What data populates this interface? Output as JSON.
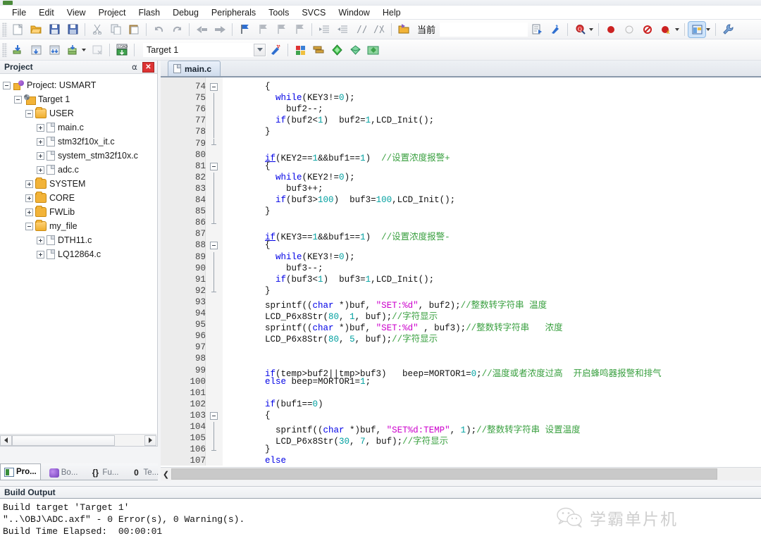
{
  "menu": {
    "items": [
      "File",
      "Edit",
      "View",
      "Project",
      "Flash",
      "Debug",
      "Peripherals",
      "Tools",
      "SVCS",
      "Window",
      "Help"
    ]
  },
  "toolbar1": {
    "icons": [
      "new-file-icon",
      "open-file-icon",
      "save-icon",
      "save-all-icon",
      "cut-icon",
      "copy-icon",
      "paste-icon",
      "undo-icon",
      "redo-icon",
      "navigate-back-icon",
      "navigate-forward-icon",
      "bookmark-toggle-icon",
      "bookmark-prev-icon",
      "bookmark-next-icon",
      "bookmark-clear-icon",
      "indent-icon",
      "outdent-icon",
      "comment-icon",
      "uncomment-icon",
      "open-project-icon"
    ],
    "current_label": "当前",
    "right_icons": [
      "target-options-icon",
      "configure-icon",
      "find-in-files-icon",
      "insert-breakpoint-icon",
      "disable-breakpoint-icon",
      "kill-breakpoints-icon",
      "disable-all-breakpoints-icon",
      "window-manage-icon",
      "utilities-icon"
    ]
  },
  "toolbar2": {
    "icons": [
      "translate-icon",
      "build-icon",
      "rebuild-all-icon",
      "batch-build-icon",
      "stop-build-icon",
      "download-icon"
    ],
    "target_value": "Target 1",
    "right_icons": [
      "target-options-wizard-icon",
      "manage-project-items-icon",
      "manage-multi-project-icon",
      "run-configuration-icon",
      "pack-installer-icon",
      "manage-runtime-env-icon"
    ]
  },
  "project_panel": {
    "title": "Project",
    "pin_icon": "pin-icon",
    "close_icon": "close-icon",
    "tree": [
      {
        "label": "Project: USMART",
        "depth": 0,
        "toggle": "minus",
        "icon": "project-icon"
      },
      {
        "label": "Target 1",
        "depth": 1,
        "toggle": "minus",
        "icon": "target-icon"
      },
      {
        "label": "USER",
        "depth": 2,
        "toggle": "minus",
        "icon": "folder-open-icon"
      },
      {
        "label": "main.c",
        "depth": 3,
        "toggle": "plus",
        "icon": "c-file-icon"
      },
      {
        "label": "stm32f10x_it.c",
        "depth": 3,
        "toggle": "plus",
        "icon": "c-file-icon"
      },
      {
        "label": "system_stm32f10x.c",
        "depth": 3,
        "toggle": "plus",
        "icon": "c-file-icon"
      },
      {
        "label": "adc.c",
        "depth": 3,
        "toggle": "plus",
        "icon": "c-file-icon"
      },
      {
        "label": "SYSTEM",
        "depth": 2,
        "toggle": "plus",
        "icon": "folder-icon"
      },
      {
        "label": "CORE",
        "depth": 2,
        "toggle": "plus",
        "icon": "folder-icon"
      },
      {
        "label": "FWLib",
        "depth": 2,
        "toggle": "plus",
        "icon": "folder-icon"
      },
      {
        "label": "my_file",
        "depth": 2,
        "toggle": "minus",
        "icon": "folder-open-icon"
      },
      {
        "label": "DTH11.c",
        "depth": 3,
        "toggle": "plus",
        "icon": "c-file-icon"
      },
      {
        "label": "LQ12864.c",
        "depth": 3,
        "toggle": "plus",
        "icon": "c-file-icon"
      }
    ]
  },
  "left_tabs": [
    {
      "label": "Pro...",
      "icon": "project-tab-icon",
      "active": true
    },
    {
      "label": "Bo...",
      "icon": "books-tab-icon",
      "active": false
    },
    {
      "label": "Fu...",
      "icon": "functions-tab-icon",
      "active": false
    },
    {
      "label": "Te...",
      "icon": "templates-tab-icon",
      "active": false
    }
  ],
  "editor": {
    "tab_label": "main.c",
    "tab_icon": "c-file-icon",
    "first_line": 74,
    "lines": [
      {
        "n": 74,
        "fold": "start",
        "tokens": [
          {
            "t": "        {",
            "c": ""
          }
        ]
      },
      {
        "n": 75,
        "fold": "bar",
        "tokens": [
          {
            "t": "          ",
            "c": ""
          },
          {
            "t": "while",
            "c": "kw"
          },
          {
            "t": "(KEY3!=",
            "c": ""
          },
          {
            "t": "0",
            "c": "num"
          },
          {
            "t": ");",
            "c": ""
          }
        ]
      },
      {
        "n": 76,
        "fold": "bar",
        "tokens": [
          {
            "t": "            buf2--;",
            "c": ""
          }
        ]
      },
      {
        "n": 77,
        "fold": "bar",
        "tokens": [
          {
            "t": "          ",
            "c": ""
          },
          {
            "t": "if",
            "c": "kw"
          },
          {
            "t": "(buf2<",
            "c": ""
          },
          {
            "t": "1",
            "c": "num"
          },
          {
            "t": ")  buf2=",
            "c": ""
          },
          {
            "t": "1",
            "c": "num"
          },
          {
            "t": ",LCD_Init();",
            "c": ""
          }
        ]
      },
      {
        "n": 78,
        "fold": "bar",
        "tokens": [
          {
            "t": "        }",
            "c": ""
          }
        ]
      },
      {
        "n": 79,
        "fold": "end",
        "tokens": [
          {
            "t": "",
            "c": ""
          }
        ]
      },
      {
        "n": 80,
        "fold": "",
        "tokens": [
          {
            "t": "        ",
            "c": ""
          },
          {
            "t": "if",
            "c": "kwu"
          },
          {
            "t": "(KEY2==",
            "c": ""
          },
          {
            "t": "1",
            "c": "num"
          },
          {
            "t": "&&buf1==",
            "c": ""
          },
          {
            "t": "1",
            "c": "num"
          },
          {
            "t": ")  ",
            "c": ""
          },
          {
            "t": "//设置浓度报警+",
            "c": "cmt"
          }
        ]
      },
      {
        "n": 81,
        "fold": "start",
        "tokens": [
          {
            "t": "        {",
            "c": ""
          }
        ]
      },
      {
        "n": 82,
        "fold": "bar",
        "tokens": [
          {
            "t": "          ",
            "c": ""
          },
          {
            "t": "while",
            "c": "kw"
          },
          {
            "t": "(KEY2!=",
            "c": ""
          },
          {
            "t": "0",
            "c": "num"
          },
          {
            "t": ");",
            "c": ""
          }
        ]
      },
      {
        "n": 83,
        "fold": "bar",
        "tokens": [
          {
            "t": "            buf3++;",
            "c": ""
          }
        ]
      },
      {
        "n": 84,
        "fold": "bar",
        "tokens": [
          {
            "t": "          ",
            "c": ""
          },
          {
            "t": "if",
            "c": "kw"
          },
          {
            "t": "(buf3>",
            "c": ""
          },
          {
            "t": "100",
            "c": "num"
          },
          {
            "t": ")  buf3=",
            "c": ""
          },
          {
            "t": "100",
            "c": "num"
          },
          {
            "t": ",LCD_Init();",
            "c": ""
          }
        ]
      },
      {
        "n": 85,
        "fold": "bar",
        "tokens": [
          {
            "t": "        }",
            "c": ""
          }
        ]
      },
      {
        "n": 86,
        "fold": "end",
        "tokens": [
          {
            "t": "",
            "c": ""
          }
        ]
      },
      {
        "n": 87,
        "fold": "",
        "tokens": [
          {
            "t": "        ",
            "c": ""
          },
          {
            "t": "if",
            "c": "kwu"
          },
          {
            "t": "(KEY3==",
            "c": ""
          },
          {
            "t": "1",
            "c": "num"
          },
          {
            "t": "&&buf1==",
            "c": ""
          },
          {
            "t": "1",
            "c": "num"
          },
          {
            "t": ")  ",
            "c": ""
          },
          {
            "t": "//设置浓度报警-",
            "c": "cmt"
          }
        ]
      },
      {
        "n": 88,
        "fold": "start",
        "tokens": [
          {
            "t": "        {",
            "c": ""
          }
        ]
      },
      {
        "n": 89,
        "fold": "bar",
        "tokens": [
          {
            "t": "          ",
            "c": ""
          },
          {
            "t": "while",
            "c": "kw"
          },
          {
            "t": "(KEY3!=",
            "c": ""
          },
          {
            "t": "0",
            "c": "num"
          },
          {
            "t": ");",
            "c": ""
          }
        ]
      },
      {
        "n": 90,
        "fold": "bar",
        "tokens": [
          {
            "t": "            buf3--;",
            "c": ""
          }
        ]
      },
      {
        "n": 91,
        "fold": "bar",
        "tokens": [
          {
            "t": "          ",
            "c": ""
          },
          {
            "t": "if",
            "c": "kw"
          },
          {
            "t": "(buf3<",
            "c": ""
          },
          {
            "t": "1",
            "c": "num"
          },
          {
            "t": ")  buf3=",
            "c": ""
          },
          {
            "t": "1",
            "c": "num"
          },
          {
            "t": ",LCD_Init();",
            "c": ""
          }
        ]
      },
      {
        "n": 92,
        "fold": "end",
        "tokens": [
          {
            "t": "        }",
            "c": ""
          }
        ]
      },
      {
        "n": 93,
        "fold": "",
        "tokens": [
          {
            "t": "        sprintf((",
            "c": ""
          },
          {
            "t": "char",
            "c": "typ"
          },
          {
            "t": " *)buf, ",
            "c": ""
          },
          {
            "t": "\"SET:%d\"",
            "c": "str"
          },
          {
            "t": ", buf2);",
            "c": ""
          },
          {
            "t": "//整数转字符串 温度",
            "c": "cmt"
          }
        ]
      },
      {
        "n": 94,
        "fold": "",
        "tokens": [
          {
            "t": "        LCD_P6x8Str(",
            "c": ""
          },
          {
            "t": "80",
            "c": "num"
          },
          {
            "t": ", ",
            "c": ""
          },
          {
            "t": "1",
            "c": "num"
          },
          {
            "t": ", buf);",
            "c": ""
          },
          {
            "t": "//字符显示",
            "c": "cmt"
          }
        ]
      },
      {
        "n": 95,
        "fold": "",
        "tokens": [
          {
            "t": "        sprintf((",
            "c": ""
          },
          {
            "t": "char",
            "c": "typ"
          },
          {
            "t": " *)buf, ",
            "c": ""
          },
          {
            "t": "\"SET:%d\"",
            "c": "str"
          },
          {
            "t": " , buf3);",
            "c": ""
          },
          {
            "t": "//整数转字符串   浓度",
            "c": "cmt"
          }
        ]
      },
      {
        "n": 96,
        "fold": "",
        "tokens": [
          {
            "t": "        LCD_P6x8Str(",
            "c": ""
          },
          {
            "t": "80",
            "c": "num"
          },
          {
            "t": ", ",
            "c": ""
          },
          {
            "t": "5",
            "c": "num"
          },
          {
            "t": ", buf);",
            "c": ""
          },
          {
            "t": "//字符显示",
            "c": "cmt"
          }
        ]
      },
      {
        "n": 97,
        "fold": "",
        "tokens": [
          {
            "t": "",
            "c": ""
          }
        ]
      },
      {
        "n": 98,
        "fold": "",
        "tokens": [
          {
            "t": "",
            "c": ""
          }
        ]
      },
      {
        "n": 99,
        "fold": "",
        "tokens": [
          {
            "t": "        ",
            "c": ""
          },
          {
            "t": "if",
            "c": "kw"
          },
          {
            "t": "(temp>buf2||tmp>buf3)   beep=MORTOR1=",
            "c": ""
          },
          {
            "t": "0",
            "c": "num"
          },
          {
            "t": ";",
            "c": ""
          },
          {
            "t": "//温度或者浓度过高  开启蜂鸣器报警和排气",
            "c": "cmt"
          }
        ]
      },
      {
        "n": 100,
        "fold": "",
        "tokens": [
          {
            "t": "        ",
            "c": ""
          },
          {
            "t": "else",
            "c": "kw"
          },
          {
            "t": " beep=MORTOR1=",
            "c": ""
          },
          {
            "t": "1",
            "c": "num"
          },
          {
            "t": ";",
            "c": ""
          }
        ]
      },
      {
        "n": 101,
        "fold": "",
        "tokens": [
          {
            "t": "",
            "c": ""
          }
        ]
      },
      {
        "n": 102,
        "fold": "",
        "tokens": [
          {
            "t": "        ",
            "c": ""
          },
          {
            "t": "if",
            "c": "kw"
          },
          {
            "t": "(buf1==",
            "c": ""
          },
          {
            "t": "0",
            "c": "num"
          },
          {
            "t": ")",
            "c": ""
          }
        ]
      },
      {
        "n": 103,
        "fold": "start",
        "tokens": [
          {
            "t": "        {",
            "c": ""
          }
        ]
      },
      {
        "n": 104,
        "fold": "bar",
        "tokens": [
          {
            "t": "          sprintf((",
            "c": ""
          },
          {
            "t": "char",
            "c": "typ"
          },
          {
            "t": " *)buf, ",
            "c": ""
          },
          {
            "t": "\"SET%d:TEMP\"",
            "c": "str"
          },
          {
            "t": ", ",
            "c": ""
          },
          {
            "t": "1",
            "c": "num"
          },
          {
            "t": ");",
            "c": ""
          },
          {
            "t": "//整数转字符串 设置温度",
            "c": "cmt"
          }
        ]
      },
      {
        "n": 105,
        "fold": "bar",
        "tokens": [
          {
            "t": "          LCD_P6x8Str(",
            "c": ""
          },
          {
            "t": "30",
            "c": "num"
          },
          {
            "t": ", ",
            "c": ""
          },
          {
            "t": "7",
            "c": "num"
          },
          {
            "t": ", buf);",
            "c": ""
          },
          {
            "t": "//字符显示",
            "c": "cmt"
          }
        ]
      },
      {
        "n": 106,
        "fold": "end",
        "tokens": [
          {
            "t": "        }",
            "c": ""
          }
        ]
      },
      {
        "n": 107,
        "fold": "",
        "tokens": [
          {
            "t": "        ",
            "c": ""
          },
          {
            "t": "else",
            "c": "kw"
          }
        ]
      }
    ],
    "colors": {
      "keyword": "#0000e6",
      "number": "#00a0a0",
      "string": "#cc00cc",
      "comment": "#3aa040"
    }
  },
  "build_output": {
    "title": "Build Output",
    "lines": [
      "Build target 'Target 1'",
      "\"..\\OBJ\\ADC.axf\" - 0 Error(s), 0 Warning(s).",
      "Build Time Elapsed:  00:00:01"
    ]
  },
  "watermark": {
    "text": "学霸单片机",
    "icon": "wechat-icon"
  }
}
